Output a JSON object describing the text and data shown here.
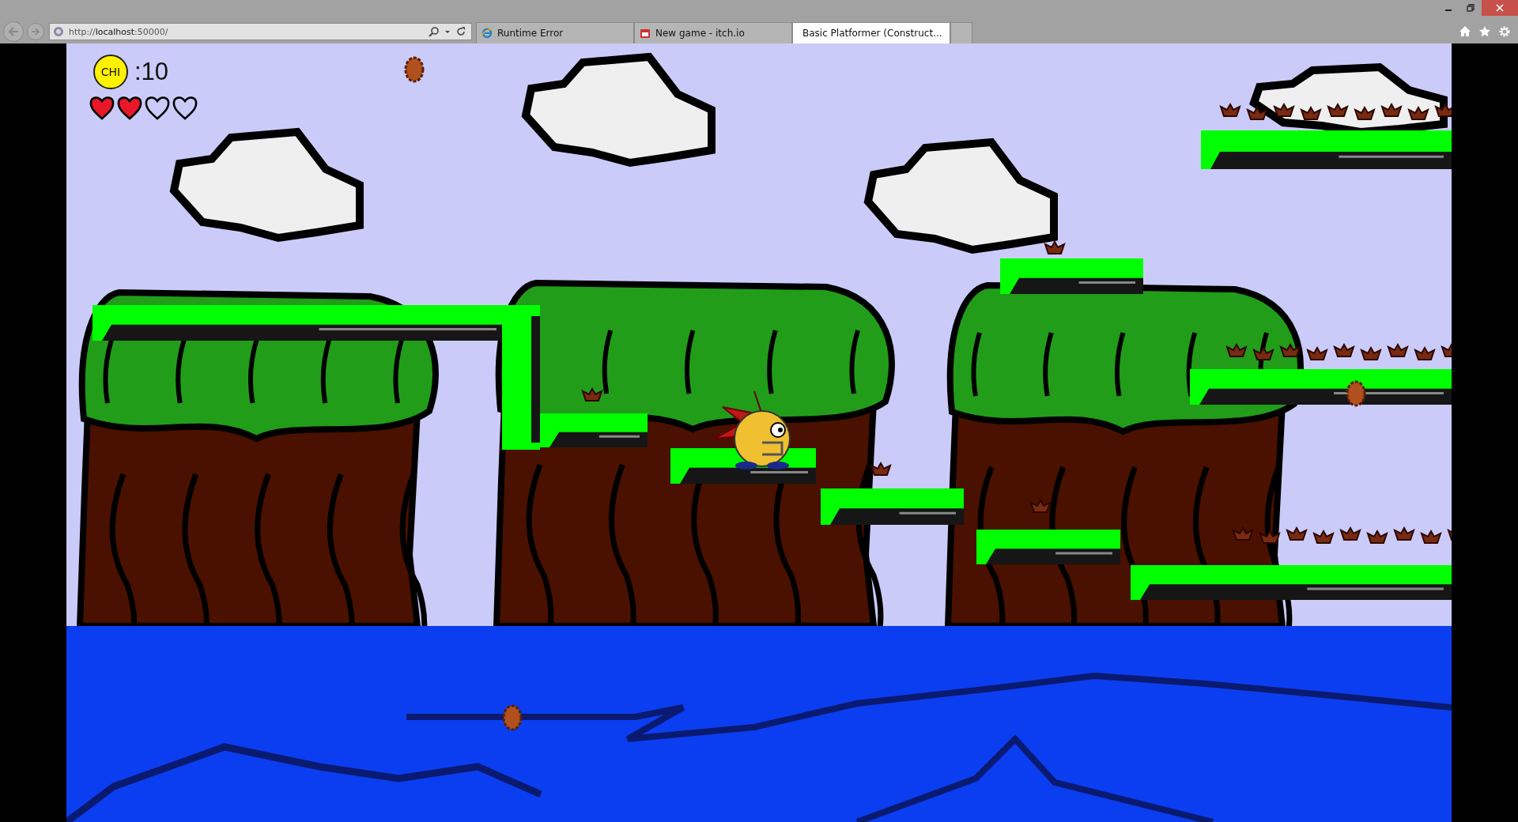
{
  "browser": {
    "address": "http://**localhost**:50000/",
    "tabs": [
      {
        "title": "Runtime Error",
        "selected": false,
        "kind": "ie"
      },
      {
        "title": "New game - itch.io",
        "selected": false,
        "kind": "itch"
      },
      {
        "title": "Basic Platformer (Construct...",
        "selected": true,
        "kind": "construct"
      }
    ]
  },
  "hud": {
    "coin_label": "CHI",
    "score": ":10",
    "hearts": [
      {
        "filled": true
      },
      {
        "filled": true
      },
      {
        "filled": false
      },
      {
        "filled": false
      }
    ]
  }
}
